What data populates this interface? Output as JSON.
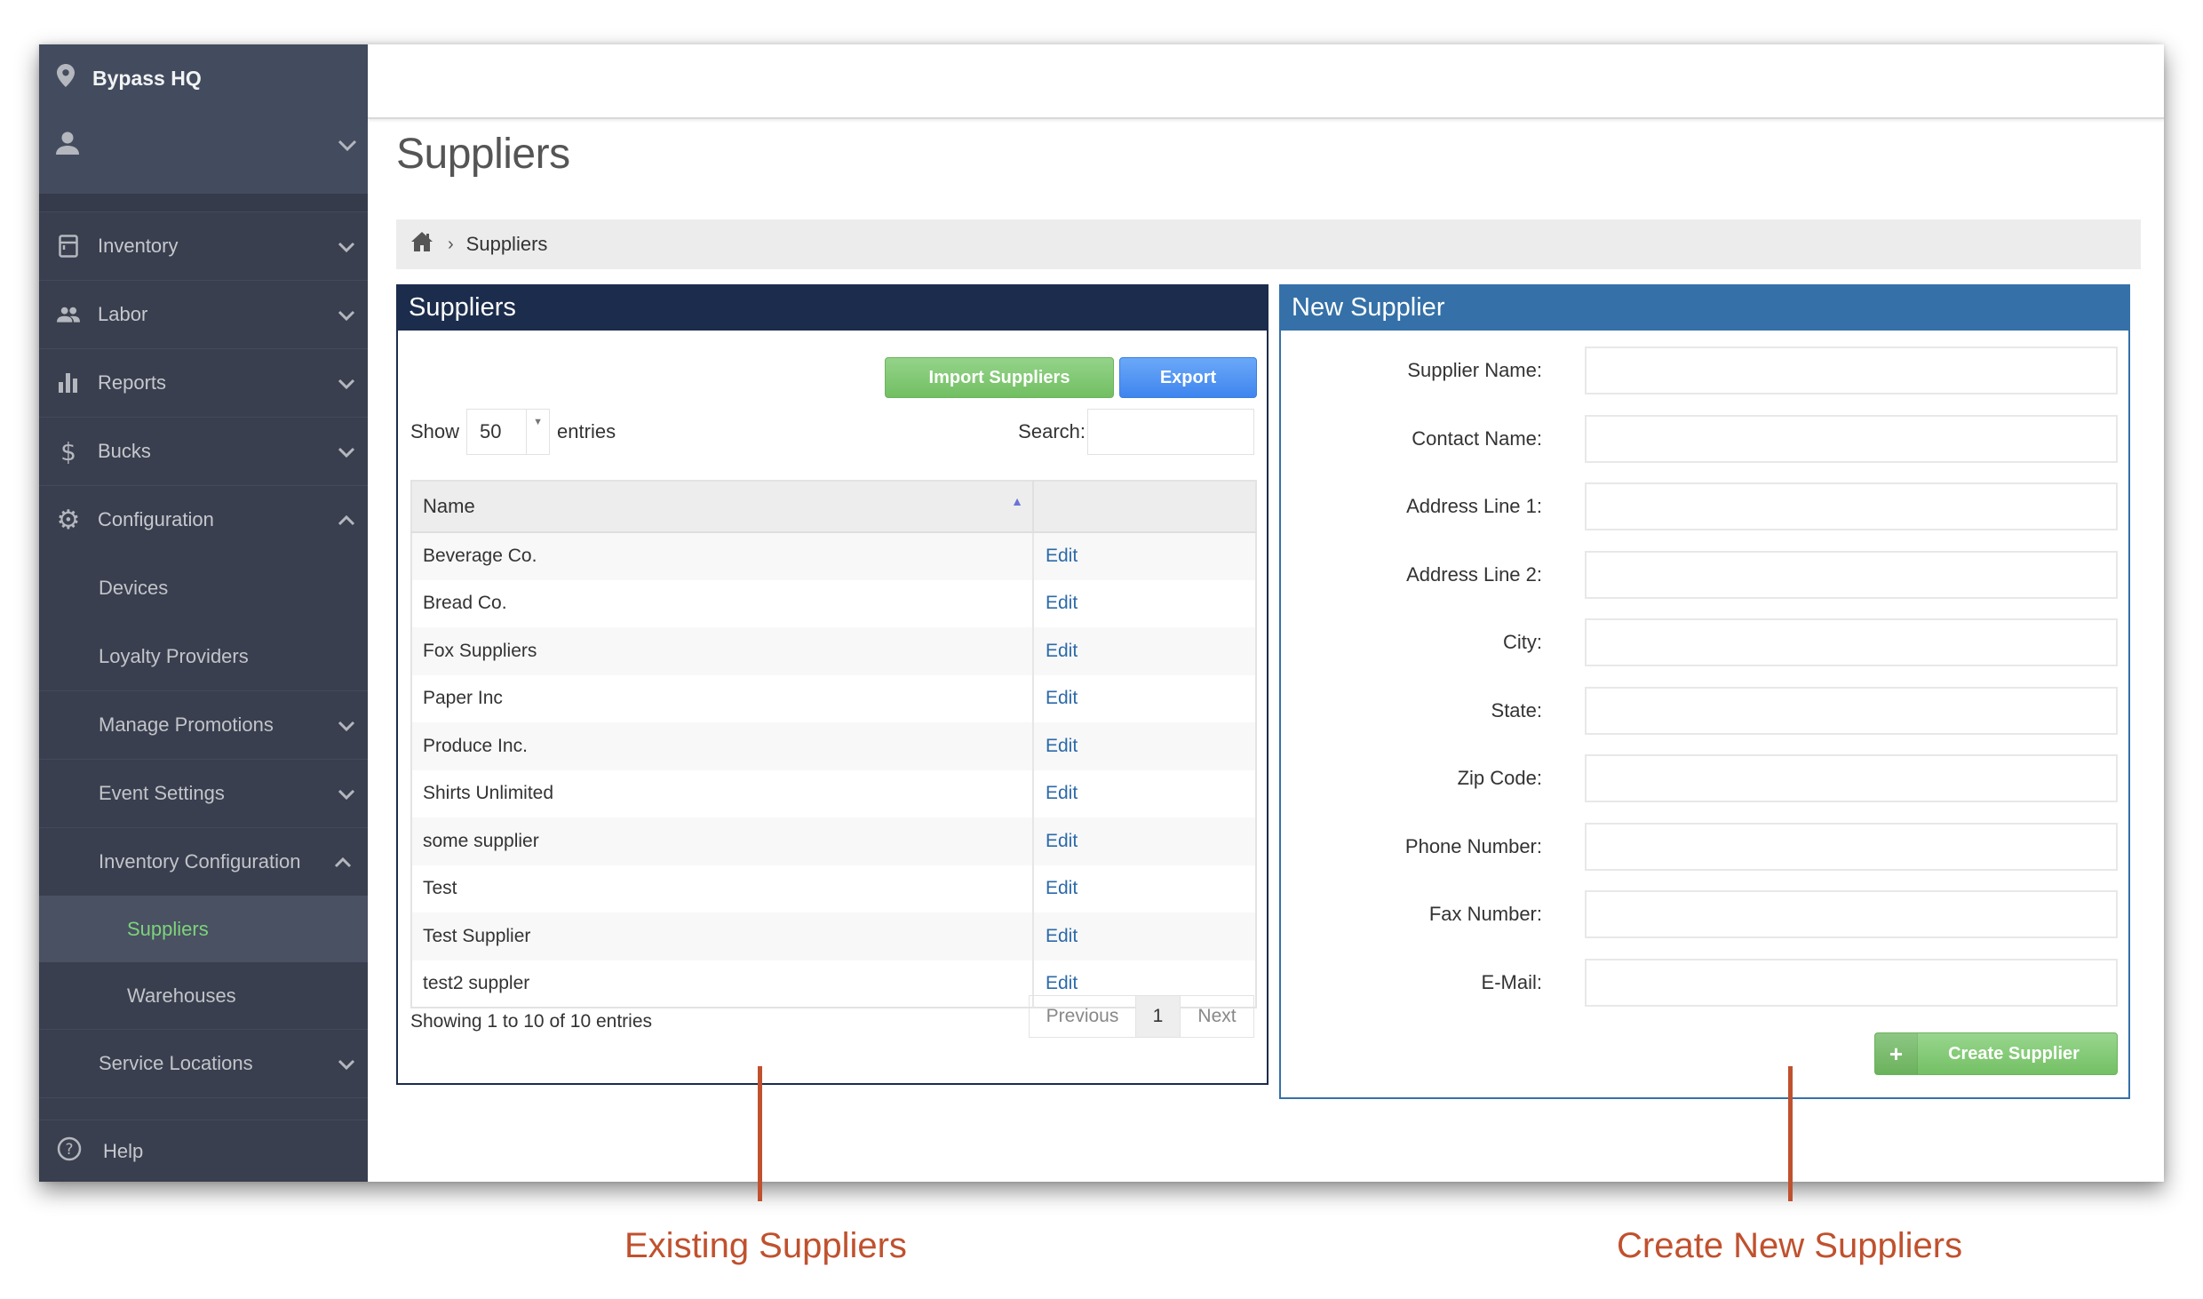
{
  "sidebar": {
    "location": "Bypass HQ",
    "items": [
      {
        "label": "Inventory",
        "icon": "inventory-icon",
        "expanded": false
      },
      {
        "label": "Labor",
        "icon": "people-icon",
        "expanded": false
      },
      {
        "label": "Reports",
        "icon": "bar-chart-icon",
        "expanded": false
      },
      {
        "label": "Bucks",
        "icon": "dollar-icon",
        "expanded": false
      },
      {
        "label": "Configuration",
        "icon": "gear-icon",
        "expanded": true
      }
    ],
    "config_children": [
      {
        "label": "Devices"
      },
      {
        "label": "Loyalty Providers"
      },
      {
        "label": "Manage Promotions"
      },
      {
        "label": "Event Settings"
      },
      {
        "label": "Inventory Configuration"
      },
      {
        "label": "Service Locations"
      }
    ],
    "inventory_config_children": [
      {
        "label": "Suppliers",
        "active": true
      },
      {
        "label": "Warehouses",
        "active": false
      }
    ],
    "help": "Help"
  },
  "page": {
    "title": "Suppliers",
    "breadcrumb": [
      "home",
      "Suppliers"
    ]
  },
  "suppliers_panel": {
    "title": "Suppliers",
    "import_label": "Import Suppliers",
    "export_label": "Export",
    "show_label": "Show",
    "page_size": "50",
    "entries_label": "entries",
    "search_label": "Search:",
    "search_value": "",
    "columns": [
      "Name",
      ""
    ],
    "rows": [
      {
        "name": "Beverage Co.",
        "action": "Edit"
      },
      {
        "name": "Bread Co.",
        "action": "Edit"
      },
      {
        "name": "Fox Suppliers",
        "action": "Edit"
      },
      {
        "name": "Paper Inc",
        "action": "Edit"
      },
      {
        "name": "Produce Inc.",
        "action": "Edit"
      },
      {
        "name": "Shirts Unlimited",
        "action": "Edit"
      },
      {
        "name": "some supplier",
        "action": "Edit"
      },
      {
        "name": "Test",
        "action": "Edit"
      },
      {
        "name": "Test Supplier",
        "action": "Edit"
      },
      {
        "name": "test2 suppler",
        "action": "Edit"
      }
    ],
    "info": "Showing 1 to 10 of 10 entries",
    "pager": {
      "previous": "Previous",
      "current": "1",
      "next": "Next"
    }
  },
  "new_supplier_panel": {
    "title": "New Supplier",
    "fields": [
      {
        "label": "Supplier Name:",
        "value": ""
      },
      {
        "label": "Contact Name:",
        "value": ""
      },
      {
        "label": "Address Line 1:",
        "value": ""
      },
      {
        "label": "Address Line 2:",
        "value": ""
      },
      {
        "label": "City:",
        "value": ""
      },
      {
        "label": "State:",
        "value": ""
      },
      {
        "label": "Zip Code:",
        "value": ""
      },
      {
        "label": "Phone Number:",
        "value": ""
      },
      {
        "label": "Fax Number:",
        "value": ""
      },
      {
        "label": "E-Mail:",
        "value": ""
      }
    ],
    "create_label": "Create Supplier",
    "create_icon": "+"
  },
  "annotations": {
    "left": "Existing Suppliers",
    "right": "Create New Suppliers"
  },
  "colors": {
    "sidebar_bg": "#393f4f",
    "active_green": "#7dd37a",
    "suppliers_header": "#1c2c4c",
    "new_supplier_header": "#3571a8",
    "annotation": "#c0512e"
  }
}
